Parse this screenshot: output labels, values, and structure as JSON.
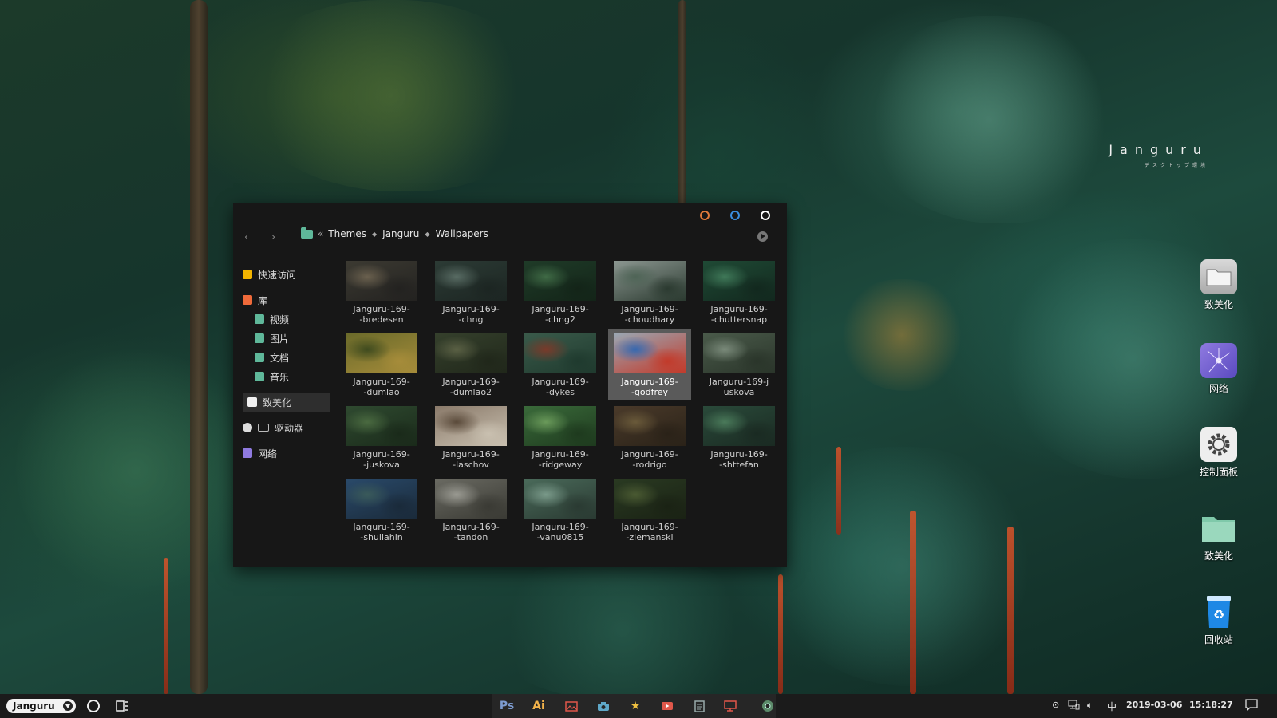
{
  "brand": {
    "title": "Janguru",
    "subtitle": "デスクトップ環境"
  },
  "explorer": {
    "window_buttons": [
      {
        "name": "minimize",
        "color": "#e07a3a"
      },
      {
        "name": "maximize",
        "color": "#3a8ee0"
      },
      {
        "name": "close",
        "color": "#ffffff"
      }
    ],
    "breadcrumb": {
      "root_marker": "«",
      "items": [
        "Themes",
        "Janguru",
        "Wallpapers"
      ]
    },
    "sidebar": {
      "quick_access": "快速访问",
      "library": "库",
      "library_items": [
        "视频",
        "图片",
        "文档",
        "音乐"
      ],
      "beautify": "致美化",
      "drives": "驱动器",
      "network": "网络"
    },
    "files": [
      {
        "line1": "Janguru-169-",
        "line2": "-bredesen",
        "palette": [
          "#3c3a32",
          "#6a604e",
          "#232220"
        ]
      },
      {
        "line1": "Janguru-169-",
        "line2": "-chng",
        "palette": [
          "#2c3b35",
          "#586b63",
          "#1c2522"
        ]
      },
      {
        "line1": "Janguru-169-",
        "line2": "-chng2",
        "palette": [
          "#1f3b28",
          "#3f6a45",
          "#132418"
        ]
      },
      {
        "line1": "Janguru-169-",
        "line2": "-choudhary",
        "palette": [
          "#8c9791",
          "#4e6456",
          "#2b3a30"
        ]
      },
      {
        "line1": "Janguru-169-",
        "line2": "-chuttersnap",
        "palette": [
          "#1f4a35",
          "#3f7858",
          "#12281e"
        ]
      },
      {
        "line1": "Janguru-169-",
        "line2": "-dumlao",
        "palette": [
          "#6a6a2a",
          "#3e4a1e",
          "#a68c3a"
        ]
      },
      {
        "line1": "Janguru-169-",
        "line2": "-dumlao2",
        "palette": [
          "#35402c",
          "#5a6044",
          "#20271a"
        ]
      },
      {
        "line1": "Janguru-169-",
        "line2": "-dykes",
        "palette": [
          "#3a5a4a",
          "#7a3a2a",
          "#1f3a2e"
        ]
      },
      {
        "line1": "Janguru-169-",
        "line2": "-godfrey",
        "palette": [
          "#9aa7b3",
          "#3568b0",
          "#c23a2a"
        ]
      },
      {
        "line1": "Janguru-169-j",
        "line2": "uskova",
        "palette": [
          "#4a5a4a",
          "#7a8a7a",
          "#2a352a"
        ]
      },
      {
        "line1": "Janguru-169-",
        "line2": "-juskova",
        "palette": [
          "#2f4a30",
          "#4a6a40",
          "#1a2a1a"
        ]
      },
      {
        "line1": "Janguru-169-",
        "line2": "-laschov",
        "palette": [
          "#8a7a6a",
          "#5a4a3a",
          "#c9c0b0"
        ]
      },
      {
        "line1": "Janguru-169-",
        "line2": "-ridgeway",
        "palette": [
          "#3a6a3a",
          "#6a9a5a",
          "#1e3a1e"
        ]
      },
      {
        "line1": "Janguru-169-",
        "line2": "-rodrigo",
        "palette": [
          "#4a3a2a",
          "#6a5a3a",
          "#2a2218"
        ]
      },
      {
        "line1": "Janguru-169-",
        "line2": "-shttefan",
        "palette": [
          "#2a4a3a",
          "#4a7a5a",
          "#1a2a22"
        ]
      },
      {
        "line1": "Janguru-169-",
        "line2": "-shuliahin",
        "palette": [
          "#2a4a6a",
          "#3a5a5a",
          "#1a2a3a"
        ]
      },
      {
        "line1": "Janguru-169-",
        "line2": "-tandon",
        "palette": [
          "#6a6a62",
          "#9a9a92",
          "#3a3a34"
        ]
      },
      {
        "line1": "Janguru-169-",
        "line2": "-vanu0815",
        "palette": [
          "#4a6a5a",
          "#7a9a8a",
          "#2a3a32"
        ]
      },
      {
        "line1": "Janguru-169-",
        "line2": "-ziemanski",
        "palette": [
          "#2a3a22",
          "#4a5a32",
          "#1a2214"
        ]
      }
    ],
    "selected_file": "-godfrey"
  },
  "desktop_icons": [
    {
      "label": "致美化",
      "icon": "folder-white-icon"
    },
    {
      "label": "网络",
      "icon": "network-icon"
    },
    {
      "label": "控制面板",
      "icon": "gear-icon"
    },
    {
      "label": "致美化",
      "icon": "folder-green-icon"
    },
    {
      "label": "回收站",
      "icon": "recycle-bin-icon"
    }
  ],
  "taskbar": {
    "start_label": "Janguru",
    "apps": [
      {
        "name": "photoshop",
        "label": "Ps",
        "color": "#7c9bd0"
      },
      {
        "name": "illustrator",
        "label": "Ai",
        "color": "#f2b24a"
      }
    ],
    "ime": "中",
    "date": "2019-03-06",
    "time": "15:18:27"
  }
}
